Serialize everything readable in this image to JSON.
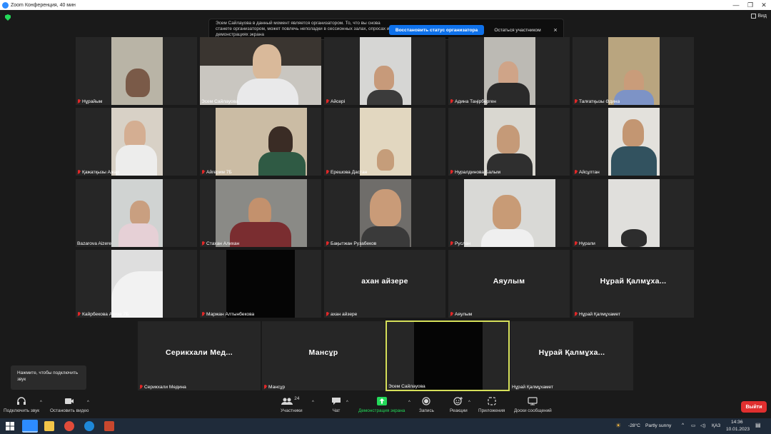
{
  "window": {
    "title": "Zoom Конференция, 40 мин",
    "view_label": "Вид"
  },
  "notice": {
    "text": "Эсем Сайлауова в данный момент является организатором. То, что вы снова станете организатором, может повлечь неполадки в сессионных залах, опросах и демонстрациях экрана",
    "primary_label": "Восстановить статус организатора",
    "secondary_label": "Остаться участником",
    "close_label": "×"
  },
  "participants": [
    {
      "name": "Нұрайым"
    },
    {
      "name": "Эсем Сайлауова"
    },
    {
      "name": "Айсері"
    },
    {
      "name": "Адина Таңірберген"
    },
    {
      "name": "Талғатқызы Әдина"
    },
    {
      "name": "Қажатқызы Ажар"
    },
    {
      "name": "Айгерим 7Б"
    },
    {
      "name": "Ерешова Дастан"
    },
    {
      "name": "Нуралдинова Балым"
    },
    {
      "name": "Айсұлтан"
    },
    {
      "name": "Bazarova Aizere"
    },
    {
      "name": "Стахан Алихан"
    },
    {
      "name": "Бақытжан Рузабеков"
    },
    {
      "name": "Руслан"
    },
    {
      "name": "Нурали"
    },
    {
      "name": "Кайрбекова Азиза 7Б"
    },
    {
      "name": "Маржан Алтынбекова"
    },
    {
      "name": "ахан айзере",
      "display": "ахан айзере"
    },
    {
      "name": "Аяулым",
      "display": "Аяулым"
    },
    {
      "name": "Нұрай Қалмұхамет",
      "display": "Нұрай Қалмұха..."
    },
    {
      "name": "Серикхали Медина",
      "display": "Серикхали Мед..."
    },
    {
      "name": "Мансұр",
      "display": "Мансұр"
    },
    {
      "name": "Эсем Сайлауова"
    },
    {
      "name": "Нұрай Қалмұхамет",
      "display": "Нұрай Қалмұха..."
    }
  ],
  "tooltip": {
    "text": "Нажмите, чтобы подключить звук"
  },
  "toolbar": {
    "audio": "Подключить звук",
    "video": "Остановить видео",
    "participants": "Участники",
    "participants_count": "24",
    "chat": "Чат",
    "share": "Демонстрация экрана",
    "record": "Запись",
    "reactions": "Реакции",
    "apps": "Приложения",
    "whiteboards": "Доски сообщений",
    "leave": "Выйти"
  },
  "colors": {
    "accent": "#0e71eb",
    "share_green": "#23d959",
    "leave_red": "#e02f2f",
    "active_border": "#d6e05a"
  },
  "taskbar": {
    "weather_temp": "-28°C",
    "weather_text": "Partly sunny",
    "lang": "ҚАЗ",
    "time": "14:36",
    "date": "10.01.2023"
  }
}
